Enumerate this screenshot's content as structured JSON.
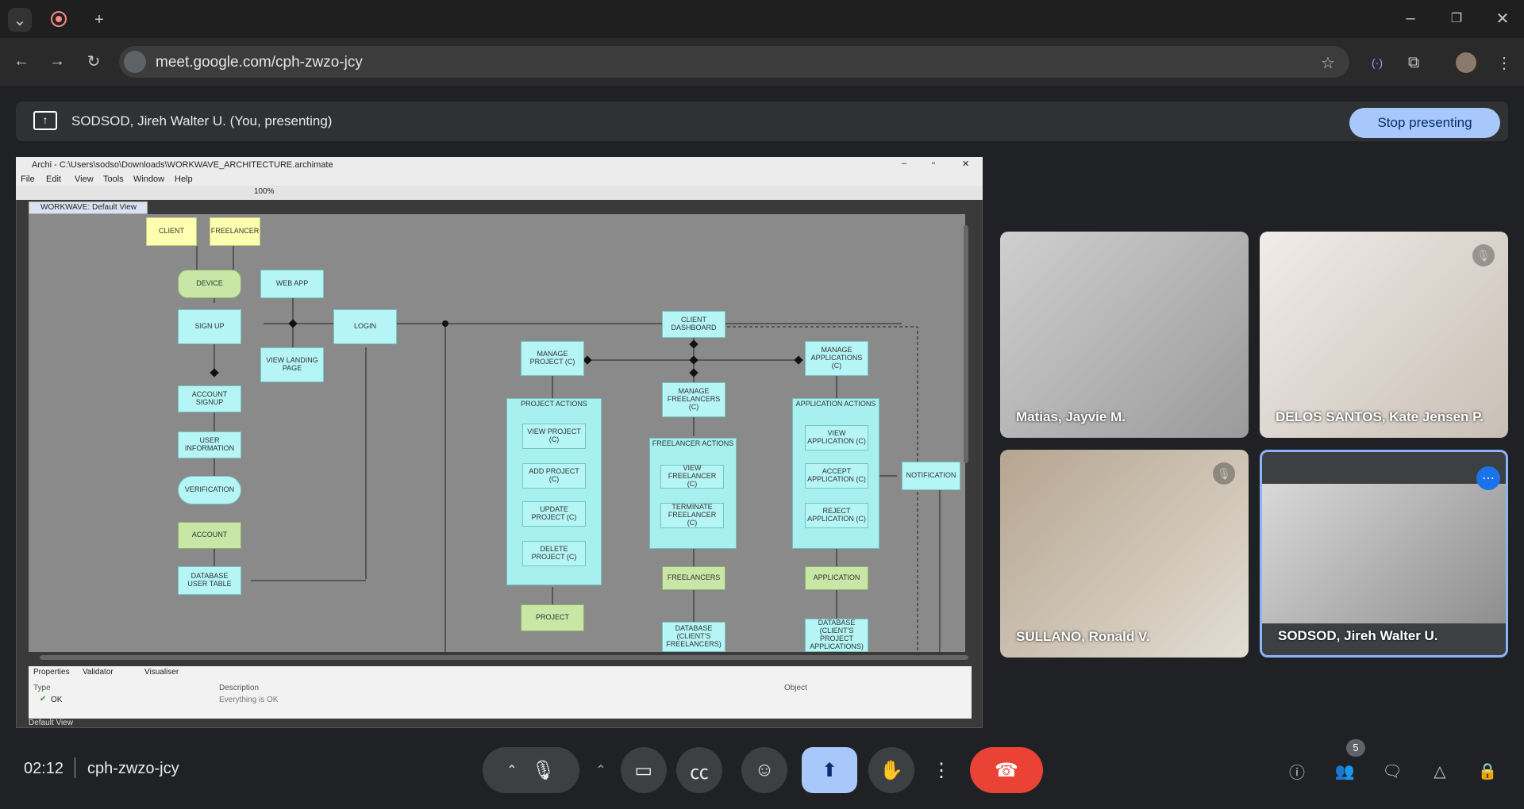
{
  "browser": {
    "url": "meet.google.com/cph-zwzo-jcy",
    "new_tab": "+"
  },
  "presenting": {
    "text": "SODSOD, Jireh Walter U. (You, presenting)",
    "stop": "Stop presenting"
  },
  "archi": {
    "title": "Archi - C:\\Users\\sodso\\Downloads\\WORKWAVE_ARCHITECTURE.archimate",
    "menu": [
      "File",
      "Edit",
      "View",
      "Tools",
      "Window",
      "Help"
    ],
    "zoom": "100%",
    "tab": "WORKWAVE: Default View",
    "nodes": {
      "client": "CLIENT",
      "freelancer": "FREELANCER",
      "device": "DEVICE",
      "webapp": "WEB APP",
      "signup": "SIGN UP",
      "login": "LOGIN",
      "landing": "VIEW LANDING PAGE",
      "accsignup": "ACCOUNT SIGNUP",
      "userinfo": "USER INFORMATION",
      "verification": "VERIFICATION",
      "account": "ACCOUNT",
      "dbuser": "DATABASE USER TABLE",
      "clientdash": "CLIENT DASHBOARD",
      "manageproj": "MANAGE PROJECT (C)",
      "managefree": "MANAGE FREELANCERS (C)",
      "manageapps": "MANAGE APPLICATIONS (C)",
      "projactions": "PROJECT ACTIONS",
      "viewproj": "VIEW PROJECT (C)",
      "addproj": "ADD PROJECT (C)",
      "updproj": "UPDATE PROJECT (C)",
      "delproj": "DELETE PROJECT (C)",
      "project": "PROJECT",
      "freeactions": "FREELANCER ACTIONS",
      "viewfree": "VIEW FREELANCER (C)",
      "termfree": "TERMINATE FREELANCER (C)",
      "freelancers": "FREELANCERS",
      "dbfree": "DATABASE (CLIENT'S FREELANCERS)",
      "appactions": "APPLICATION ACTIONS",
      "viewapp": "VIEW APPLICATION (C)",
      "acceptapp": "ACCEPT APPLICATION (C)",
      "rejectapp": "REJECT APPLICATION (C)",
      "notification": "NOTIFICATION",
      "application": "APPLICATION",
      "dbapp": "DATABASE (CLIENT'S PROJECT APPLICATIONS)"
    },
    "panel_tabs": [
      "Properties",
      "Validator",
      "Visualiser"
    ],
    "cols": {
      "type": "Type",
      "desc": "Description",
      "obj": "Object"
    },
    "row": {
      "type": "OK",
      "desc": "Everything is OK"
    },
    "status": "Default View"
  },
  "participants": [
    "Matias, Jayvie M.",
    "DELOS SANTOS, Kate Jensen P.",
    "SULLANO, Ronald V.",
    "SODSOD, Jireh Walter U."
  ],
  "meeting": {
    "time": "02:12",
    "code": "cph-zwzo-jcy",
    "people_count": "5"
  }
}
